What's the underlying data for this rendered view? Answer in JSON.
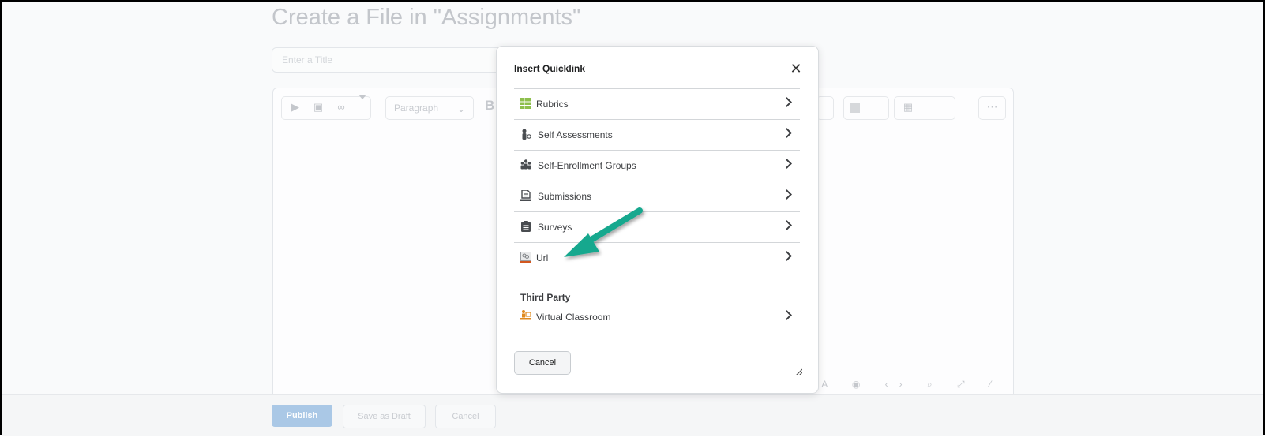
{
  "page": {
    "title": "Create a File in \"Assignments\"",
    "title_placeholder": "Enter a Title",
    "paragraph_label": "Paragraph"
  },
  "footer": {
    "publish_label": "Publish",
    "draft_label": "Save as Draft",
    "cancel_label": "Cancel"
  },
  "modal": {
    "title": "Insert Quicklink",
    "items": [
      {
        "label": "Rubrics",
        "icon": "rubrics-icon"
      },
      {
        "label": "Self Assessments",
        "icon": "self-assessment-icon"
      },
      {
        "label": "Self-Enrollment Groups",
        "icon": "groups-icon"
      },
      {
        "label": "Submissions",
        "icon": "submissions-icon"
      },
      {
        "label": "Surveys",
        "icon": "surveys-icon"
      },
      {
        "label": "Url",
        "icon": "url-icon"
      }
    ],
    "third_party_heading": "Third Party",
    "third_party_items": [
      {
        "label": "Virtual Classroom",
        "icon": "virtual-classroom-icon"
      }
    ],
    "cancel_label": "Cancel"
  },
  "colors": {
    "accent_arrow": "#19a88e",
    "publish_button": "#aac8e6"
  }
}
